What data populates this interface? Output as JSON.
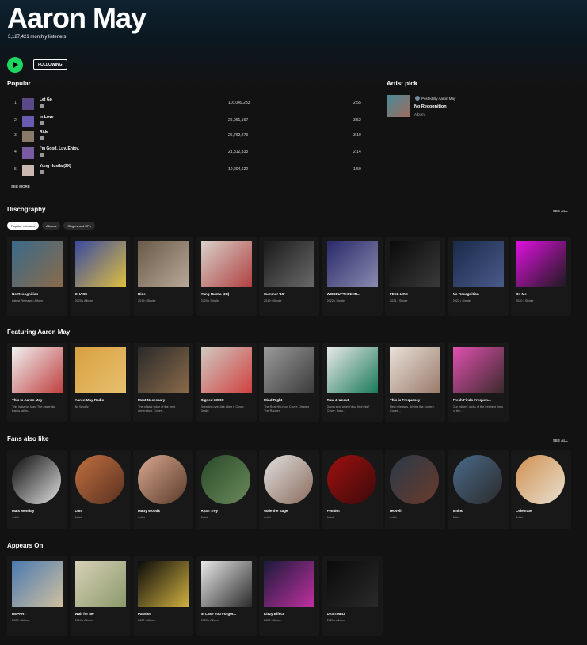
{
  "artist": {
    "name": "Aaron May",
    "monthly_listeners": "3,127,421 monthly listeners"
  },
  "controls": {
    "follow_label": "FOLLOWING",
    "more_label": "···"
  },
  "popular": {
    "title": "Popular",
    "see_more": "SEE MORE",
    "tracks": [
      {
        "num": "1",
        "title": "Let Go",
        "plays": "116,049,233",
        "duration": "2:55",
        "color": "#5a4a8a"
      },
      {
        "num": "2",
        "title": "In Love",
        "plays": "26,061,167",
        "duration": "3:52",
        "color": "#6a5ab0"
      },
      {
        "num": "3",
        "title": "Ride",
        "plays": "26,762,273",
        "duration": "3:10",
        "color": "#8a7a6a"
      },
      {
        "num": "4",
        "title": "I'm Good. Luv, Enjoy.",
        "plays": "21,312,333",
        "duration": "2:14",
        "color": "#7a5aa0"
      },
      {
        "num": "5",
        "title": "Yung Hustla (2X)",
        "plays": "10,204,622",
        "duration": "1:50",
        "color": "#c9b7b0"
      }
    ]
  },
  "artist_pick": {
    "title": "Artist pick",
    "posted_by": "Posted By Aaron May",
    "item_title": "No Recognition",
    "item_type": "Album"
  },
  "discography": {
    "title": "Discography",
    "see_all": "SEE ALL",
    "chips": [
      "Popular releases",
      "Albums",
      "Singles and EPs"
    ],
    "items": [
      {
        "title": "No Recognition",
        "sub": "Latest Release • Album",
        "c1": "#3a6a8a",
        "c2": "#8a6a4a"
      },
      {
        "title": "CHASE",
        "sub": "2020 • Album",
        "c1": "#3a4aa0",
        "c2": "#e0c040"
      },
      {
        "title": "Ride",
        "sub": "2019 • Single",
        "c1": "#6a5a4a",
        "c2": "#b8a898"
      },
      {
        "title": "Yung Hustla (2X)",
        "sub": "2020 • Single",
        "c1": "#d8d0c8",
        "c2": "#b04040"
      },
      {
        "title": "Summer '19'",
        "sub": "2019 • Single",
        "c1": "#1a1a1a",
        "c2": "#6a6a6a"
      },
      {
        "title": "WOKEUPTHINKIN...",
        "sub": "2022 • Single",
        "c1": "#2a2a6a",
        "c2": "#8a8ab0"
      },
      {
        "title": "FEEL LIKE",
        "sub": "2021 • Single",
        "c1": "#0a0a0a",
        "c2": "#3a3a3a"
      },
      {
        "title": "No Recognition",
        "sub": "2022 • Single",
        "c1": "#1a2a4a",
        "c2": "#4a5a8a"
      },
      {
        "title": "On Me",
        "sub": "2020 • Single",
        "c1": "#e010e0",
        "c2": "#1a1a1a"
      }
    ]
  },
  "featuring": {
    "title": "Featuring Aaron May",
    "items": [
      {
        "title": "This Is Aaron May",
        "sub": "This is Aaron May. The essential tracks, all in...",
        "c1": "#f0f0f0",
        "c2": "#c04040"
      },
      {
        "title": "Aaron May Radio",
        "sub": "By Spotify",
        "c1": "#d8a040",
        "c2": "#e8c070"
      },
      {
        "title": "Most Necessary",
        "sub": "The official voice of the next generation. Cover...",
        "c1": "#2a2a2a",
        "c2": "#8a6a4a"
      },
      {
        "title": "Signed XOXO",
        "sub": "Dressing over-like Allen I. Cover: Drake",
        "c1": "#d0c8c0",
        "c2": "#d04040"
      },
      {
        "title": "Mind Right",
        "sub": "The Real Hip-hop. Cover: Dhanee The Rapper",
        "c1": "#9a9a9a",
        "c2": "#3a3a3a"
      },
      {
        "title": "Raw & Uncut",
        "sub": "Damn son, where'd ya find this? Cover: Joey...",
        "c1": "#e8e8e8",
        "c2": "#1a7a5a"
      },
      {
        "title": "This is Frequency",
        "sub": "New releases, driving the current. Cover:...",
        "c1": "#e8e0d8",
        "c2": "#9a7a6a"
      },
      {
        "title": "Fresh Finds Frequen...",
        "sub": "Our editors' picks of the freshest finds of the...",
        "c1": "#e050b0",
        "c2": "#3a2a2a"
      }
    ]
  },
  "fans_also_like": {
    "title": "Fans also like",
    "see_all": "SEE ALL",
    "items": [
      {
        "title": "Malx Monday",
        "sub": "Artist",
        "c1": "#0a0a0a",
        "c2": "#e0e0e0"
      },
      {
        "title": "Lute",
        "sub": "Artist",
        "c1": "#c07040",
        "c2": "#5a3020"
      },
      {
        "title": "Matty Wood$",
        "sub": "Artist",
        "c1": "#d8a890",
        "c2": "#5a3a2a"
      },
      {
        "title": "Ryan Trey",
        "sub": "Artist",
        "c1": "#2a4a2a",
        "c2": "#6a8a5a"
      },
      {
        "title": "Wale the Sage",
        "sub": "Artist",
        "c1": "#e0e0e0",
        "c2": "#8a6a5a"
      },
      {
        "title": "Femdot",
        "sub": "Artist",
        "c1": "#a01010",
        "c2": "#3a0a0a"
      },
      {
        "title": "redveil",
        "sub": "Artist",
        "c1": "#2a3a4a",
        "c2": "#6a3a2a"
      },
      {
        "title": "6mino",
        "sub": "Artist",
        "c1": "#4a6a8a",
        "c2": "#2a2a2a"
      },
      {
        "title": "Celebrate",
        "sub": "Artist",
        "c1": "#d09050",
        "c2": "#e8e0d0"
      }
    ]
  },
  "appears_on": {
    "title": "Appears On",
    "items": [
      {
        "title": "DEPART",
        "sub": "2020 • Album",
        "c1": "#4a7ab0",
        "c2": "#d0c0a0"
      },
      {
        "title": "Wait for Me",
        "sub": "2019 • Album",
        "c1": "#d8d0b8",
        "c2": "#8a9a6a"
      },
      {
        "title": "Passion",
        "sub": "2022 • Album",
        "c1": "#0a0a0a",
        "c2": "#d0b040"
      },
      {
        "title": "In Case You Forgot...",
        "sub": "2022 • Album",
        "c1": "#e8e8e8",
        "c2": "#2a2a2a"
      },
      {
        "title": "Kizzy Effect",
        "sub": "2022 • Album",
        "c1": "#1a1a3a",
        "c2": "#c030a0"
      },
      {
        "title": "DESTINED",
        "sub": "2021 • Album",
        "c1": "#0a0a0a",
        "c2": "#2a2a2a"
      }
    ]
  }
}
